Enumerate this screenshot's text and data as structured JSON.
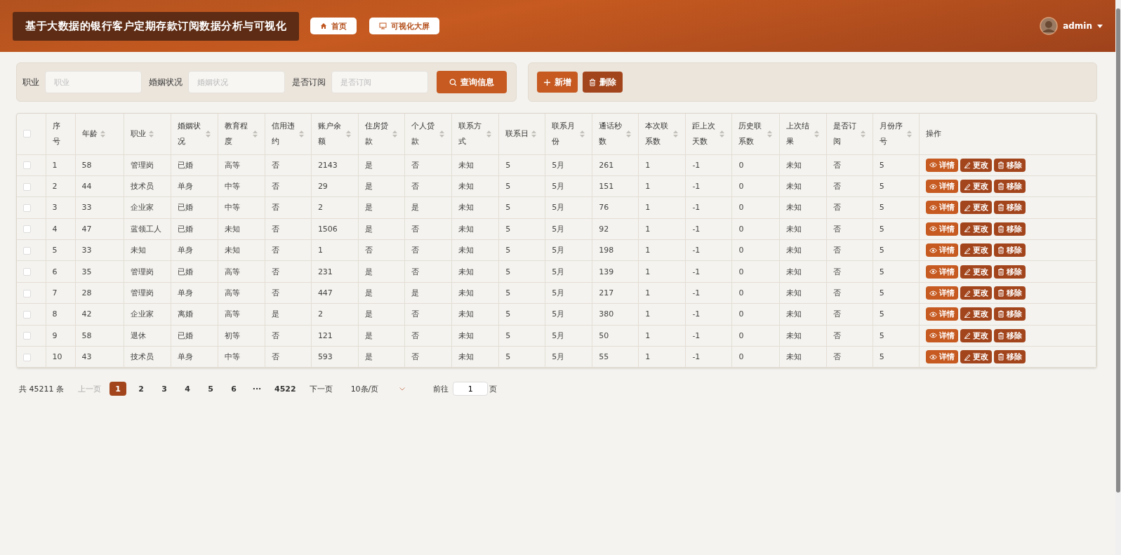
{
  "header": {
    "title": "基于大数据的银行客户定期存款订阅数据分析与可视化",
    "nav": [
      {
        "label": "首页",
        "kind": "home"
      },
      {
        "label": "可视化大屏",
        "kind": "screen"
      }
    ],
    "user": "admin"
  },
  "search": {
    "fields": [
      {
        "label": "职业",
        "placeholder": "职业"
      },
      {
        "label": "婚姻状况",
        "placeholder": "婚姻状况"
      },
      {
        "label": "是否订阅",
        "placeholder": "是否订阅"
      }
    ],
    "button": "查询信息"
  },
  "actions": [
    {
      "label": "新增",
      "kind": "add"
    },
    {
      "label": "删除",
      "kind": "delete"
    }
  ],
  "table": {
    "all_checked": false,
    "columns": [
      {
        "label": "序号",
        "sortable": false
      },
      {
        "label": "年龄",
        "sortable": true
      },
      {
        "label": "职业",
        "sortable": true
      },
      {
        "label": "婚姻状况",
        "sortable": true
      },
      {
        "label": "教育程度",
        "sortable": true
      },
      {
        "label": "信用违约",
        "sortable": true
      },
      {
        "label": "账户余额",
        "sortable": true
      },
      {
        "label": "住房贷款",
        "sortable": true
      },
      {
        "label": "个人贷款",
        "sortable": true
      },
      {
        "label": "联系方式",
        "sortable": true
      },
      {
        "label": "联系日",
        "sortable": true
      },
      {
        "label": "联系月份",
        "sortable": true
      },
      {
        "label": "通话秒数",
        "sortable": true
      },
      {
        "label": "本次联系数",
        "sortable": true
      },
      {
        "label": "距上次天数",
        "sortable": true
      },
      {
        "label": "历史联系数",
        "sortable": true
      },
      {
        "label": "上次结果",
        "sortable": true
      },
      {
        "label": "是否订阅",
        "sortable": true
      },
      {
        "label": "月份序号",
        "sortable": true
      },
      {
        "label": "操作",
        "sortable": false
      }
    ],
    "rows": [
      {
        "checked": false,
        "cells": [
          "1",
          "58",
          "管理岗",
          "已婚",
          "高等",
          "否",
          "2143",
          "是",
          "否",
          "未知",
          "5",
          "5月",
          "261",
          "1",
          "-1",
          "0",
          "未知",
          "否",
          "5"
        ],
        "actions": [
          {
            "label": "详情",
            "kind": "view"
          },
          {
            "label": "更改",
            "kind": "edit"
          },
          {
            "label": "移除",
            "kind": "delete"
          }
        ]
      },
      {
        "checked": false,
        "cells": [
          "2",
          "44",
          "技术员",
          "单身",
          "中等",
          "否",
          "29",
          "是",
          "否",
          "未知",
          "5",
          "5月",
          "151",
          "1",
          "-1",
          "0",
          "未知",
          "否",
          "5"
        ],
        "actions": [
          {
            "label": "详情",
            "kind": "view"
          },
          {
            "label": "更改",
            "kind": "edit"
          },
          {
            "label": "移除",
            "kind": "delete"
          }
        ]
      },
      {
        "checked": false,
        "cells": [
          "3",
          "33",
          "企业家",
          "已婚",
          "中等",
          "否",
          "2",
          "是",
          "是",
          "未知",
          "5",
          "5月",
          "76",
          "1",
          "-1",
          "0",
          "未知",
          "否",
          "5"
        ],
        "actions": [
          {
            "label": "详情",
            "kind": "view"
          },
          {
            "label": "更改",
            "kind": "edit"
          },
          {
            "label": "移除",
            "kind": "delete"
          }
        ]
      },
      {
        "checked": false,
        "cells": [
          "4",
          "47",
          "蓝领工人",
          "已婚",
          "未知",
          "否",
          "1506",
          "是",
          "否",
          "未知",
          "5",
          "5月",
          "92",
          "1",
          "-1",
          "0",
          "未知",
          "否",
          "5"
        ],
        "actions": [
          {
            "label": "详情",
            "kind": "view"
          },
          {
            "label": "更改",
            "kind": "edit"
          },
          {
            "label": "移除",
            "kind": "delete"
          }
        ]
      },
      {
        "checked": false,
        "cells": [
          "5",
          "33",
          "未知",
          "单身",
          "未知",
          "否",
          "1",
          "否",
          "否",
          "未知",
          "5",
          "5月",
          "198",
          "1",
          "-1",
          "0",
          "未知",
          "否",
          "5"
        ],
        "actions": [
          {
            "label": "详情",
            "kind": "view"
          },
          {
            "label": "更改",
            "kind": "edit"
          },
          {
            "label": "移除",
            "kind": "delete"
          }
        ]
      },
      {
        "checked": false,
        "cells": [
          "6",
          "35",
          "管理岗",
          "已婚",
          "高等",
          "否",
          "231",
          "是",
          "否",
          "未知",
          "5",
          "5月",
          "139",
          "1",
          "-1",
          "0",
          "未知",
          "否",
          "5"
        ],
        "actions": [
          {
            "label": "详情",
            "kind": "view"
          },
          {
            "label": "更改",
            "kind": "edit"
          },
          {
            "label": "移除",
            "kind": "delete"
          }
        ]
      },
      {
        "checked": false,
        "cells": [
          "7",
          "28",
          "管理岗",
          "单身",
          "高等",
          "否",
          "447",
          "是",
          "是",
          "未知",
          "5",
          "5月",
          "217",
          "1",
          "-1",
          "0",
          "未知",
          "否",
          "5"
        ],
        "actions": [
          {
            "label": "详情",
            "kind": "view"
          },
          {
            "label": "更改",
            "kind": "edit"
          },
          {
            "label": "移除",
            "kind": "delete"
          }
        ]
      },
      {
        "checked": false,
        "cells": [
          "8",
          "42",
          "企业家",
          "离婚",
          "高等",
          "是",
          "2",
          "是",
          "否",
          "未知",
          "5",
          "5月",
          "380",
          "1",
          "-1",
          "0",
          "未知",
          "否",
          "5"
        ],
        "actions": [
          {
            "label": "详情",
            "kind": "view"
          },
          {
            "label": "更改",
            "kind": "edit"
          },
          {
            "label": "移除",
            "kind": "delete"
          }
        ]
      },
      {
        "checked": false,
        "cells": [
          "9",
          "58",
          "退休",
          "已婚",
          "初等",
          "否",
          "121",
          "是",
          "否",
          "未知",
          "5",
          "5月",
          "50",
          "1",
          "-1",
          "0",
          "未知",
          "否",
          "5"
        ],
        "actions": [
          {
            "label": "详情",
            "kind": "view"
          },
          {
            "label": "更改",
            "kind": "edit"
          },
          {
            "label": "移除",
            "kind": "delete"
          }
        ]
      },
      {
        "checked": false,
        "cells": [
          "10",
          "43",
          "技术员",
          "单身",
          "中等",
          "否",
          "593",
          "是",
          "否",
          "未知",
          "5",
          "5月",
          "55",
          "1",
          "-1",
          "0",
          "未知",
          "否",
          "5"
        ],
        "actions": [
          {
            "label": "详情",
            "kind": "view"
          },
          {
            "label": "更改",
            "kind": "edit"
          },
          {
            "label": "移除",
            "kind": "delete"
          }
        ]
      }
    ]
  },
  "pagination": {
    "total": "共 45211 条",
    "prev": "上一页",
    "pages": [
      {
        "label": "1",
        "selected": true
      },
      {
        "label": "2",
        "selected": false
      },
      {
        "label": "3",
        "selected": false
      },
      {
        "label": "4",
        "selected": false
      },
      {
        "label": "5",
        "selected": false
      },
      {
        "label": "6",
        "selected": false
      },
      {
        "label": "···",
        "selected": false
      },
      {
        "label": "4522",
        "selected": false
      }
    ],
    "next": "下一页",
    "page_size": "10条/页",
    "goto_label": "前往",
    "goto_value": "1",
    "goto_suffix": "页"
  }
}
